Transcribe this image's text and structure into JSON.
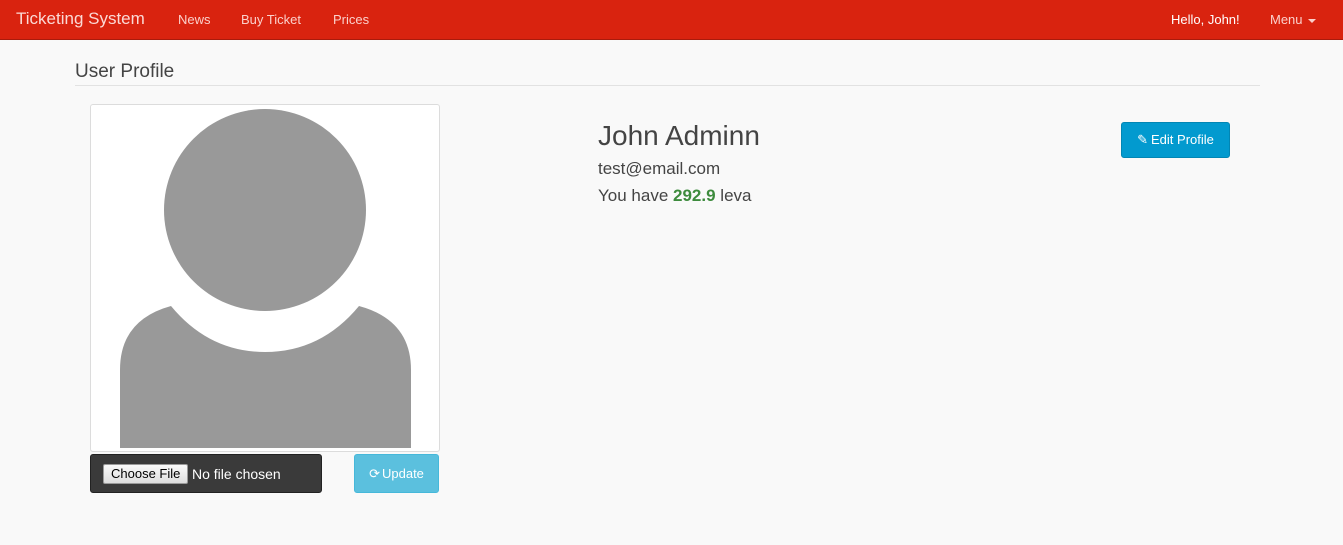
{
  "navbar": {
    "brand": "Ticketing System",
    "links": [
      "News",
      "Buy Ticket",
      "Prices"
    ],
    "greeting": "Hello, John!",
    "menu_label": "Menu",
    "color": "#d9230f"
  },
  "page": {
    "title": "User Profile"
  },
  "upload": {
    "choose_label": "Choose File",
    "status": "No file chosen",
    "update_label": "Update",
    "update_icon": "refresh-icon"
  },
  "profile": {
    "name": "John Adminn",
    "email": "test@email.com",
    "balance_prefix": "You have",
    "balance_amount": "292.9",
    "balance_suffix": "leva",
    "avatar_icon": "default-avatar-icon"
  },
  "actions": {
    "edit_label": "Edit Profile",
    "edit_icon": "pencil-icon",
    "edit_color": "#029acf"
  }
}
